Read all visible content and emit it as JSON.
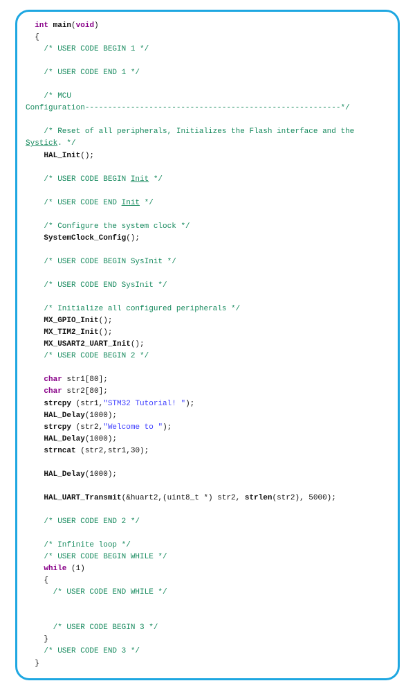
{
  "code": {
    "sig_kw1": "int",
    "sig_fn": " main",
    "sig_paren_open": "(",
    "sig_kw2": "void",
    "sig_paren_close": ")",
    "brace_open": "{",
    "c1": "/* USER CODE BEGIN 1 */",
    "c2": "/* USER CODE END 1 */",
    "c3a": "/* MCU",
    "c3b": "Configuration--------------------------------------------------------*/",
    "c4a": "/* Reset of all peripherals, Initializes the Flash interface and the ",
    "c4_systick": "Systick",
    "c4b": ". */",
    "hal_init_fn": "HAL_Init",
    "hal_init_rest": "();",
    "c5a": "/* USER CODE BEGIN ",
    "c5_init": "Init",
    "c5b": " */",
    "c6a": "/* USER CODE END ",
    "c6_init": "Init",
    "c6b": " */",
    "c7": "/* Configure the system clock */",
    "sysclk_fn": "SystemClock_Config",
    "sysclk_rest": "();",
    "c8": "/* USER CODE BEGIN SysInit */",
    "c9": "/* USER CODE END SysInit */",
    "c10": "/* Initialize all configured peripherals */",
    "mx_gpio_fn": "MX_GPIO_Init",
    "mx_gpio_rest": "();",
    "mx_tim2_fn": "MX_TIM2_Init",
    "mx_tim2_rest": "();",
    "mx_usart_fn": "MX_USART2_UART_Init",
    "mx_usart_rest": "();",
    "c11": "/* USER CODE BEGIN 2 */",
    "decl1_kw": "char",
    "decl1_rest": " str1[80];",
    "decl2_kw": "char",
    "decl2_rest": " str2[80];",
    "strcpy1_fn": "strcpy",
    "strcpy1_mid": " (str1,",
    "strcpy1_str": "\"STM32 Tutorial! \"",
    "strcpy1_end": ");",
    "delay1_fn": "HAL_Delay",
    "delay1_rest": "(1000);",
    "strcpy2_fn": "strcpy",
    "strcpy2_mid": " (str2,",
    "strcpy2_str": "\"Welcome to \"",
    "strcpy2_end": ");",
    "delay2_fn": "HAL_Delay",
    "delay2_rest": "(1000);",
    "strncat_fn": "strncat",
    "strncat_rest": " (str2,str1,30);",
    "delay3_fn": "HAL_Delay",
    "delay3_rest": "(1000);",
    "uart_fn": "HAL_UART_Transmit",
    "uart_a": "(&huart2,(uint8_t *) str2, ",
    "uart_strlen": "strlen",
    "uart_b": "(str2), 5000);",
    "c12": "/* USER CODE END 2 */",
    "c13": "/* Infinite loop */",
    "c14": "/* USER CODE BEGIN WHILE */",
    "while_kw": "while",
    "while_rest": " (1)",
    "brace_while_open": "{",
    "c15": "/* USER CODE END WHILE */",
    "c16": "/* USER CODE BEGIN 3 */",
    "brace_while_close": "}",
    "c17": "/* USER CODE END 3 */",
    "brace_close": "}"
  }
}
